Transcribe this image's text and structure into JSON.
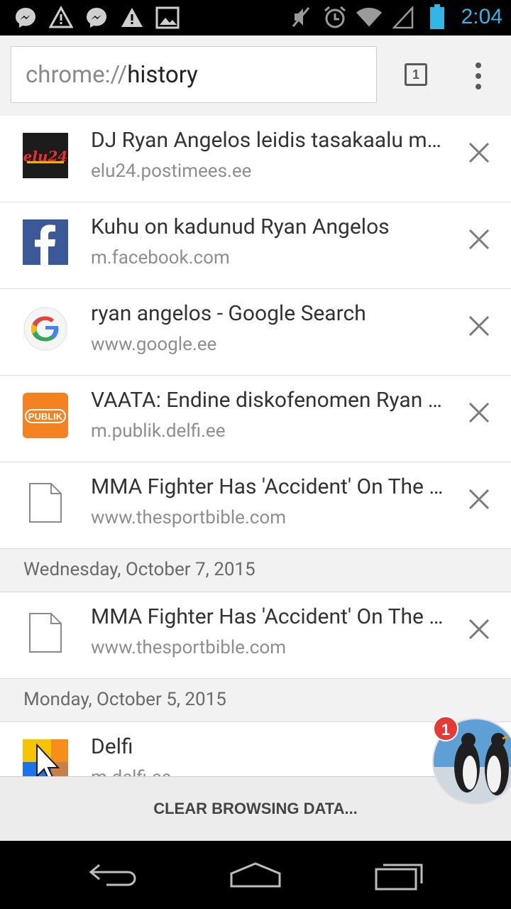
{
  "status_bar": {
    "time": "2:04",
    "icons": [
      "messenger-icon",
      "warning-icon",
      "messenger-icon",
      "warning-icon",
      "image-icon",
      "mute-icon",
      "alarm-icon",
      "wifi-icon",
      "signal-icon",
      "battery-icon"
    ]
  },
  "toolbar": {
    "url_scheme": "chrome://",
    "url_host": "history",
    "tab_count": "1",
    "menu_icon": "more-vert-icon"
  },
  "history": {
    "entries": [
      {
        "title": "DJ Ryan Angelos leidis tasakaalu mees",
        "url": "elu24.postimees.ee",
        "favicon": "elu24-favicon"
      },
      {
        "title": "Kuhu on kadunud Ryan Angelos",
        "url": "m.facebook.com",
        "favicon": "facebook-favicon"
      },
      {
        "title": "ryan angelos - Google Search",
        "url": "www.google.ee",
        "favicon": "google-favicon"
      },
      {
        "title": "VAATA: Endine diskofenomen Ryan Angelos",
        "url": "m.publik.delfi.ee",
        "favicon": "publik-favicon"
      },
      {
        "title": "MMA Fighter Has 'Accident' On The Mat",
        "url": "www.thesportbible.com",
        "favicon": "page-icon"
      }
    ],
    "groups": [
      {
        "date": "Wednesday, October 7, 2015",
        "entries": [
          {
            "title": "MMA Fighter Has 'Accident' On The Mat",
            "url": "www.thesportbible.com",
            "favicon": "page-icon"
          }
        ]
      },
      {
        "date": "Monday, October 5, 2015",
        "entries": [
          {
            "title": "Delfi",
            "url": "m.delfi.ee",
            "favicon": "delfi-favicon"
          }
        ]
      }
    ]
  },
  "clear_button": {
    "label": "CLEAR BROWSING DATA..."
  },
  "chat_head": {
    "badge_count": "1"
  },
  "nav_bar": {
    "icons": [
      "back-icon",
      "home-icon",
      "recents-icon"
    ]
  },
  "colors": {
    "status_time": "#33b5e5",
    "badge": "#e53935",
    "toolbar_bg": "#f2f2f2"
  }
}
